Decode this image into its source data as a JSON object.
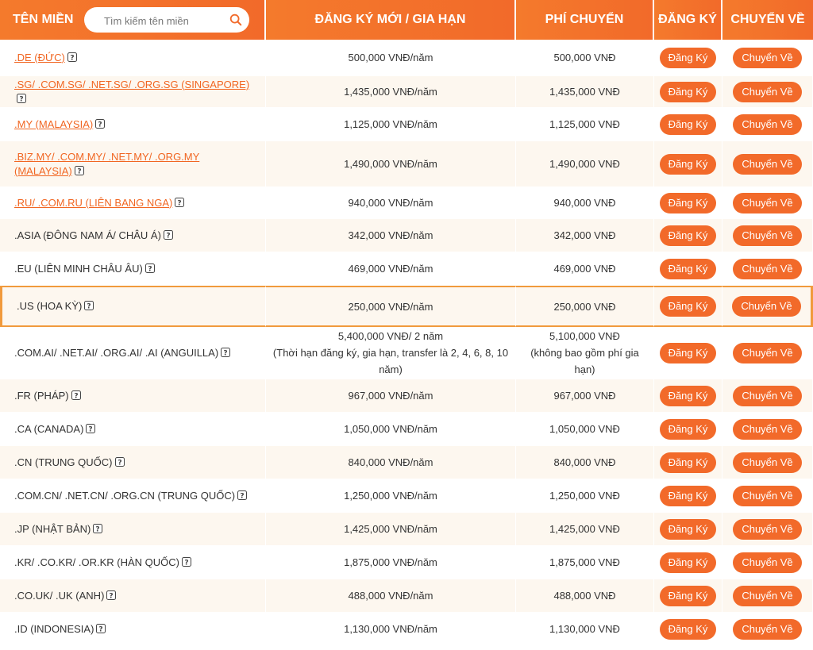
{
  "header": {
    "domain_col": "TÊN MIỀN",
    "search_placeholder": "Tìm kiếm tên miền",
    "register_col": "ĐĂNG KÝ MỚI / GIA HẠN",
    "transfer_fee_col": "PHÍ CHUYỂN",
    "register_btn_col": "ĐĂNG KÝ",
    "transfer_btn_col": "CHUYỂN VỀ"
  },
  "colors": {
    "accent": "#f26a2a",
    "highlight_border": "#f19a3c",
    "alt_row": "#fdf7ef"
  },
  "button_labels": {
    "register": "Đăng Ký",
    "transfer": "Chuyển Về"
  },
  "rows": [
    {
      "domain": ".DE (ĐỨC)",
      "link": true,
      "register": "500,000 VNĐ/năm",
      "transfer": "500,000 VNĐ"
    },
    {
      "domain": ".SG/ .COM.SG/ .NET.SG/ .ORG.SG (SINGAPORE)",
      "link": true,
      "register": "1,435,000 VNĐ/năm",
      "transfer": "1,435,000 VNĐ"
    },
    {
      "domain": ".MY (MALAYSIA)",
      "link": true,
      "register": "1,125,000 VNĐ/năm",
      "transfer": "1,125,000 VNĐ"
    },
    {
      "domain": ".BIZ.MY/ .COM.MY/ .NET.MY/ .ORG.MY (MALAYSIA)",
      "link": true,
      "register": "1,490,000 VNĐ/năm",
      "transfer": "1,490,000 VNĐ"
    },
    {
      "domain": ".RU/ .COM.RU (LIÊN BANG NGA)",
      "link": true,
      "register": "940,000 VNĐ/năm",
      "transfer": "940,000 VNĐ"
    },
    {
      "domain": ".ASIA (ĐÔNG NAM Á/ CHÂU Á)",
      "link": false,
      "register": "342,000 VNĐ/năm",
      "transfer": "342,000 VNĐ"
    },
    {
      "domain": ".EU (LIÊN MINH CHÂU ÂU)",
      "link": false,
      "register": "469,000 VNĐ/năm",
      "transfer": "469,000 VNĐ"
    },
    {
      "domain": ".US (HOA KỲ)",
      "link": false,
      "register": "250,000 VNĐ/năm",
      "transfer": "250,000 VNĐ",
      "highlighted": true
    },
    {
      "domain": ".COM.AI/ .NET.AI/ .ORG.AI/ .AI (ANGUILLA)",
      "link": false,
      "register": "5,400,000 VNĐ/ 2 năm",
      "register_note": "(Thời hạn đăng ký, gia hạn, transfer là 2, 4, 6, 8, 10 năm)",
      "transfer": "5,100,000 VNĐ",
      "transfer_note": "(không bao gồm phí gia hạn)"
    },
    {
      "domain": ".FR (PHÁP)",
      "link": false,
      "register": "967,000 VNĐ/năm",
      "transfer": "967,000 VNĐ"
    },
    {
      "domain": ".CA (CANADA)",
      "link": false,
      "register": "1,050,000 VNĐ/năm",
      "transfer": "1,050,000 VNĐ"
    },
    {
      "domain": ".CN (TRUNG QUỐC)",
      "link": false,
      "register": "840,000 VNĐ/năm",
      "transfer": "840,000 VNĐ"
    },
    {
      "domain": ".COM.CN/ .NET.CN/ .ORG.CN (TRUNG QUỐC)",
      "link": false,
      "register": "1,250,000 VNĐ/năm",
      "transfer": "1,250,000 VNĐ"
    },
    {
      "domain": ".JP (NHẬT BẢN)",
      "link": false,
      "register": "1,425,000 VNĐ/năm",
      "transfer": "1,425,000 VNĐ"
    },
    {
      "domain": ".KR/ .CO.KR/ .OR.KR (HÀN QUỐC)",
      "link": false,
      "register": "1,875,000 VNĐ/năm",
      "transfer": "1,875,000 VNĐ"
    },
    {
      "domain": ".CO.UK/ .UK (ANH)",
      "link": false,
      "register": "488,000 VNĐ/năm",
      "transfer": "488,000 VNĐ"
    },
    {
      "domain": ".ID (INDONESIA)",
      "link": false,
      "register": "1,130,000 VNĐ/năm",
      "transfer": "1,130,000 VNĐ"
    }
  ]
}
